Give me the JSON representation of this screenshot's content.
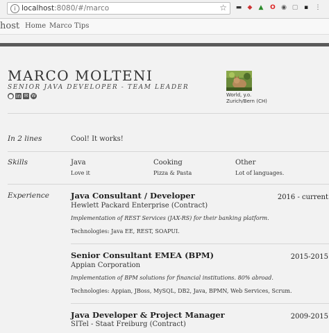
{
  "browser": {
    "url_host": "localhost",
    "url_rest": ":8080/#/marco",
    "star_icon": "star-icon",
    "extensions": [
      "mask-icon",
      "shield-icon",
      "tree-icon",
      "opera-icon",
      "circle-icon",
      "square-icon",
      "book-icon",
      "menu-icon"
    ]
  },
  "navbar": {
    "brand": "host",
    "items": [
      "Home",
      "Marco",
      "Tips"
    ]
  },
  "profile": {
    "name": "MARCO MOLTENI",
    "role": "SENIOR JAVA DEVELOPER - TEAM LEADER",
    "social_icons": [
      "github-icon",
      "linkedin-icon",
      "mail-icon",
      "wordpress-icon"
    ],
    "location_line1": "World, y.o.",
    "location_line2": "Zurich/Bern (CH)"
  },
  "summary": {
    "label": "In 2 lines",
    "text": "Cool! It works!"
  },
  "skills": {
    "label": "Skills",
    "items": [
      {
        "name": "Java",
        "desc": "Love it"
      },
      {
        "name": "Cooking",
        "desc": "Pizza & Pasta"
      },
      {
        "name": "Other",
        "desc": "Lot of languages."
      }
    ]
  },
  "experience": {
    "label": "Experience",
    "jobs": [
      {
        "title": "Java Consultant / Developer",
        "company": "Hewlett Packard Enterprise (Contract)",
        "dates": "2016 - current",
        "desc": "Implementation of REST Services (JAX-RS) for their banking platform.",
        "tech": "Technologies: Java EE, REST, SOAPUI."
      },
      {
        "title": "Senior Consultant EMEA (BPM)",
        "company": "Appian Corporation",
        "dates": "2015-2015",
        "desc": "Implementation of BPM solutions for financial institutions. 80% abroad.",
        "tech": "Technologies: Appian, JBoss, MySQL, DB2, Java, BPMN, Web Services, Scrum."
      },
      {
        "title": "Java Developer & Project Manager",
        "company": "SITel - Staat Freiburg (Contract)",
        "dates": "2009-2015",
        "desc": "",
        "tech": ""
      }
    ]
  }
}
